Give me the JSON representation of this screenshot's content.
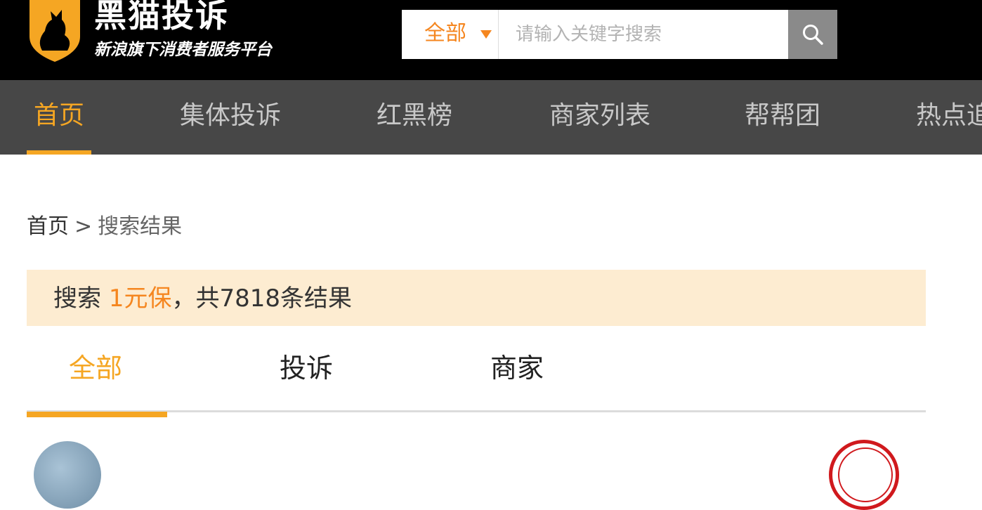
{
  "header": {
    "brand_title": "黑猫投诉",
    "brand_slogan": "新浪旗下消费者服务平台",
    "logo_icon": "black-cat-shield-icon",
    "accent_color": "#f5a623"
  },
  "search": {
    "scope_label": "全部",
    "placeholder": "请输入关键字搜索",
    "value": "",
    "button_icon": "search-icon"
  },
  "nav": {
    "items": [
      {
        "label": "首页",
        "active": true
      },
      {
        "label": "集体投诉",
        "active": false
      },
      {
        "label": "红黑榜",
        "active": false
      },
      {
        "label": "商家列表",
        "active": false
      },
      {
        "label": "帮帮团",
        "active": false
      },
      {
        "label": "热点追",
        "active": false
      }
    ]
  },
  "breadcrumb": {
    "home": "首页",
    "separator": ">",
    "current": "搜索结果"
  },
  "summary": {
    "prefix": "搜索 ",
    "keyword": "1元保",
    "suffix": "，共7818条结果"
  },
  "tabs": {
    "items": [
      {
        "label": "全部",
        "active": true
      },
      {
        "label": "投诉",
        "active": false
      },
      {
        "label": "商家",
        "active": false
      }
    ]
  }
}
